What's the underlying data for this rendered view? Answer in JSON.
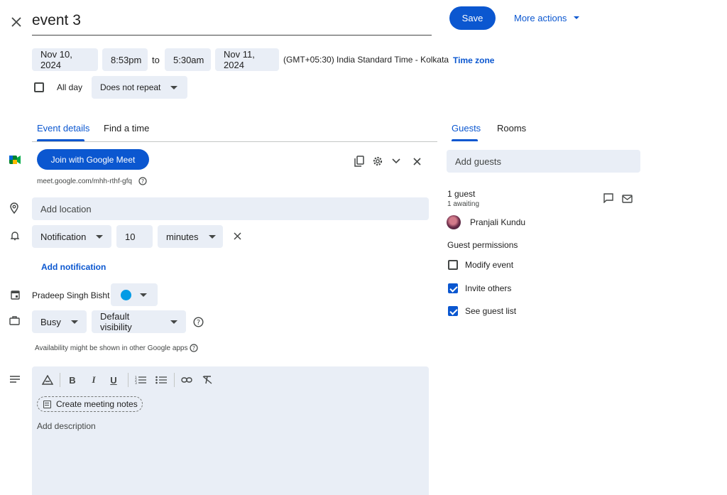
{
  "header": {
    "title": "event 3",
    "save_label": "Save",
    "more_actions_label": "More actions"
  },
  "datetime": {
    "start_date": "Nov 10, 2024",
    "start_time": "8:53pm",
    "to_label": "to",
    "end_time": "5:30am",
    "end_date": "Nov 11, 2024",
    "timezone_text": "(GMT+05:30) India Standard Time - Kolkata",
    "timezone_link": "Time zone",
    "all_day_label": "All day",
    "repeat_value": "Does not repeat"
  },
  "tabs": {
    "event_details": "Event details",
    "find_a_time": "Find a time",
    "guests": "Guests",
    "rooms": "Rooms"
  },
  "meet": {
    "join_label": "Join with Google Meet",
    "link": "meet.google.com/mhh-rthf-gfq"
  },
  "location": {
    "placeholder": "Add location"
  },
  "notification": {
    "type": "Notification",
    "amount": "10",
    "unit": "minutes",
    "add_label": "Add notification"
  },
  "calendar": {
    "owner": "Pradeep Singh Bisht",
    "color": "#039be5"
  },
  "availability": {
    "status": "Busy",
    "visibility": "Default visibility",
    "note": "Availability might be shown in other Google apps"
  },
  "description": {
    "create_notes_label": "Create meeting notes",
    "placeholder": "Add description"
  },
  "guests": {
    "add_placeholder": "Add guests",
    "count": "1 guest",
    "awaiting": "1 awaiting",
    "list": [
      {
        "name": "Pranjali Kundu"
      }
    ],
    "permissions_title": "Guest permissions",
    "permissions": [
      {
        "label": "Modify event",
        "checked": false
      },
      {
        "label": "Invite others",
        "checked": true
      },
      {
        "label": "See guest list",
        "checked": true
      }
    ]
  },
  "colors": {
    "accent": "#0b57d0",
    "chip_bg": "#e9eef6"
  }
}
